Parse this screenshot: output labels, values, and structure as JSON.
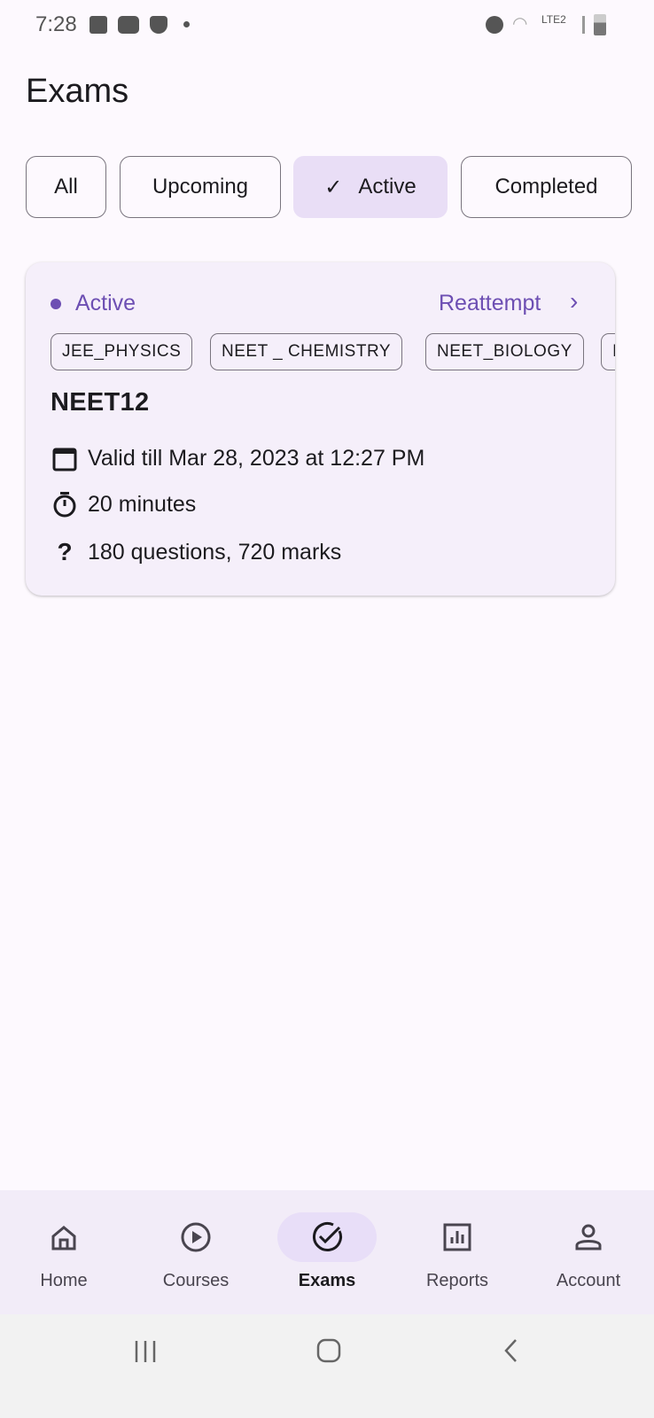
{
  "status_bar": {
    "time": "7:28",
    "network": "LTE2"
  },
  "header": {
    "title": "Exams"
  },
  "filters": [
    {
      "label": "All",
      "selected": false
    },
    {
      "label": "Upcoming",
      "selected": false
    },
    {
      "label": "Active",
      "selected": true
    },
    {
      "label": "Completed",
      "selected": false
    }
  ],
  "exam_card": {
    "status": "Active",
    "action": "Reattempt",
    "tags": [
      "JEE_PHYSICS",
      "NEET _ CHEMISTRY",
      "NEET_BIOLOGY",
      "I"
    ],
    "name": "NEET12",
    "validity": "Valid till Mar 28, 2023 at 12:27 PM",
    "duration": "20 minutes",
    "questions": "180 questions, 720 marks"
  },
  "bottom_nav": [
    {
      "label": "Home",
      "icon": "home-icon"
    },
    {
      "label": "Courses",
      "icon": "play-circle-icon"
    },
    {
      "label": "Exams",
      "icon": "check-circle-icon",
      "selected": true
    },
    {
      "label": "Reports",
      "icon": "chart-icon"
    },
    {
      "label": "Account",
      "icon": "person-icon"
    }
  ],
  "colors": {
    "accent": "#6d4fb3",
    "selected_chip": "#e9def6",
    "card": "#f5effa",
    "nav": "#f2ecf8"
  }
}
